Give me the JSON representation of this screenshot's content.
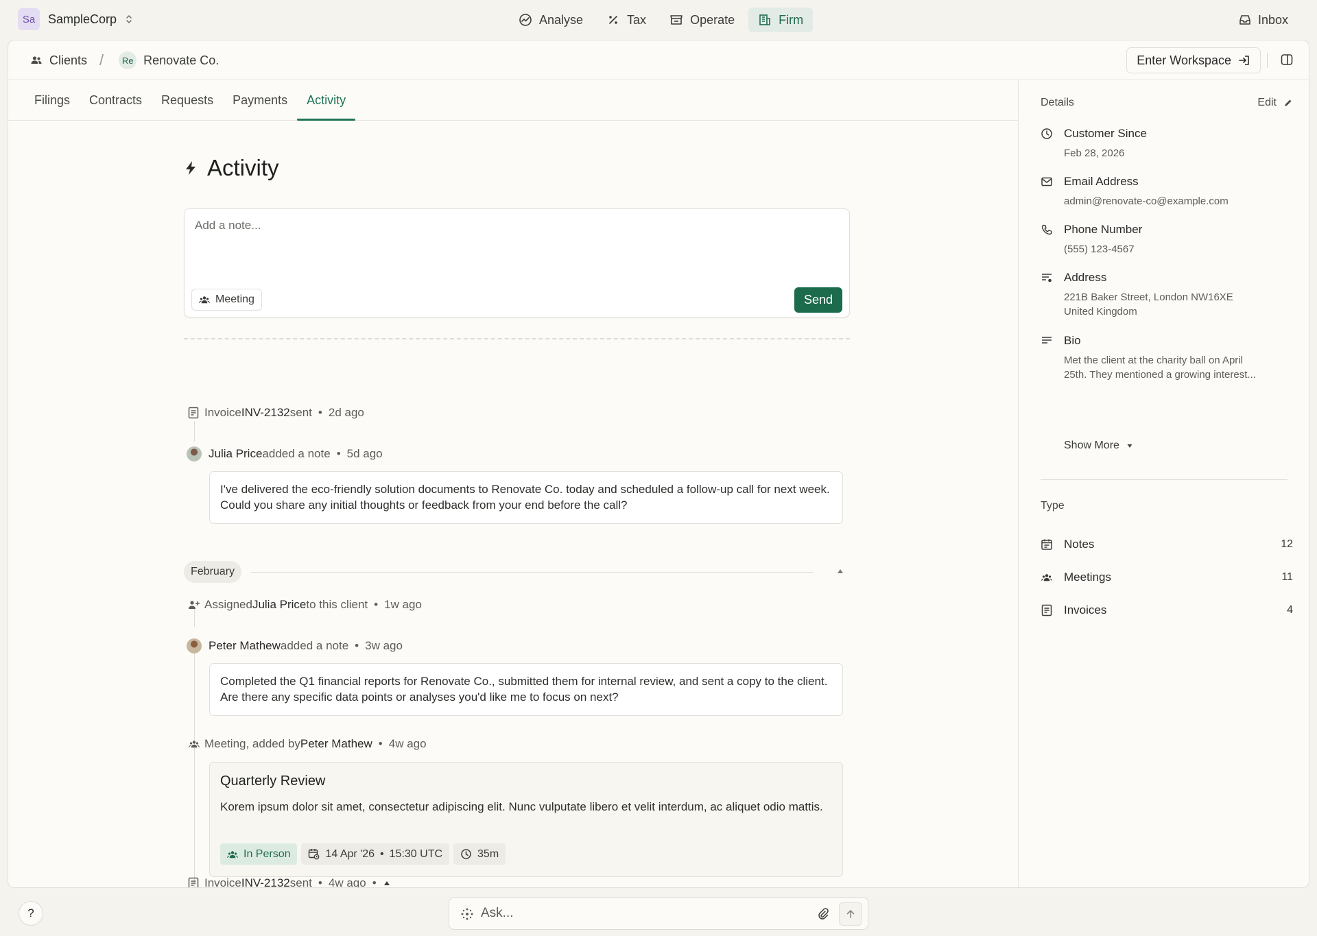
{
  "org": {
    "badge": "Sa",
    "name": "SampleCorp"
  },
  "nav": {
    "items": [
      {
        "label": "Analyse",
        "icon": "analytics-icon"
      },
      {
        "label": "Tax",
        "icon": "percent-icon"
      },
      {
        "label": "Operate",
        "icon": "store-icon"
      },
      {
        "label": "Firm",
        "icon": "building-icon",
        "active": true
      }
    ],
    "inbox": "Inbox"
  },
  "breadcrumb": {
    "clients": "Clients",
    "separator": "/",
    "client_badge": "Re",
    "client": "Renovate Co."
  },
  "header": {
    "enter_workspace": "Enter Workspace"
  },
  "tabs": [
    "Filings",
    "Contracts",
    "Requests",
    "Payments",
    "Activity"
  ],
  "active_tab": "Activity",
  "activity": {
    "title": "Activity",
    "composer": {
      "placeholder": "Add a note...",
      "type_chip": "Meeting",
      "send": "Send"
    },
    "events": {
      "e1": {
        "prefix": "Invoice ",
        "ref": "INV-2132",
        "suffix": " sent",
        "time": "2d ago"
      },
      "e2": {
        "user": "Julia Price",
        "action": " added a note",
        "time": "5d ago",
        "note": "I've delivered the eco-friendly solution documents to Renovate Co. today and scheduled a follow-up call for next week. Could you share any initial thoughts or feedback from your end before the call?"
      },
      "month": "February",
      "e3": {
        "prefix": "Assigned ",
        "user": "Julia Price",
        "suffix": " to this client",
        "time": "1w ago"
      },
      "e4": {
        "user": "Peter Mathew",
        "action": " added a note",
        "time": "3w ago",
        "note": "Completed the Q1 financial reports for Renovate Co., submitted them for internal review, and sent a copy to the client. Are there any specific data points or analyses you'd like me to focus on next?"
      },
      "e5": {
        "prefix": "Meeting, added by ",
        "user": "Peter Mathew",
        "time": "4w ago",
        "meeting": {
          "title": "Quarterly Review",
          "description": "Korem ipsum dolor sit amet, consectetur adipiscing elit. Nunc vulputate libero et velit interdum, ac aliquet odio mattis.",
          "mode": "In Person",
          "date": "14 Apr '26",
          "time": "15:30 UTC",
          "duration": "35m"
        }
      },
      "e6": {
        "prefix": "Invoice ",
        "ref": "INV-2132",
        "suffix": " sent",
        "time": "4w ago"
      }
    }
  },
  "details": {
    "heading": "Details",
    "edit": "Edit",
    "customer_since": {
      "label": "Customer Since",
      "value": "Feb 28, 2026"
    },
    "email": {
      "label": "Email Address",
      "value": "admin@renovate-co@example.com"
    },
    "phone": {
      "label": "Phone Number",
      "value": "(555) 123-4567"
    },
    "address": {
      "label": "Address",
      "line1": "221B Baker Street, London NW16XE",
      "line2": "United Kingdom"
    },
    "bio": {
      "label": "Bio",
      "line1": "Met the client at the charity ball on April",
      "line2": "25th. They mentioned a growing interest..."
    },
    "show_more": "Show More"
  },
  "types": {
    "heading": "Type",
    "items": [
      {
        "label": "Notes",
        "count": "12",
        "icon": "calendar-note-icon"
      },
      {
        "label": "Meetings",
        "count": "11",
        "icon": "people-icon"
      },
      {
        "label": "Invoices",
        "count": "4",
        "icon": "receipt-icon"
      }
    ]
  },
  "bottom": {
    "help": "?",
    "ask_placeholder": "Ask..."
  },
  "colors": {
    "accent": "#1f7256",
    "send": "#1c6b4c",
    "page_bg": "#f4f3ee",
    "panel_bg": "#fcfbf8"
  }
}
